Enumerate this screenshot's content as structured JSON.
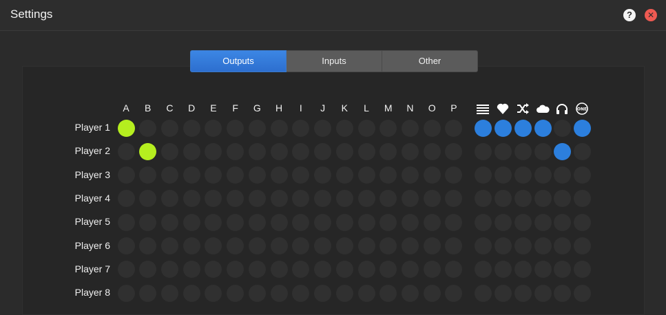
{
  "window": {
    "title": "Settings"
  },
  "controls": {
    "help_label": "?",
    "close_label": "✕"
  },
  "tabs": [
    {
      "label": "Outputs",
      "active": true
    },
    {
      "label": "Inputs",
      "active": false
    },
    {
      "label": "Other",
      "active": false
    }
  ],
  "columns": [
    "A",
    "B",
    "C",
    "D",
    "E",
    "F",
    "G",
    "H",
    "I",
    "J",
    "K",
    "L",
    "M",
    "N",
    "O",
    "P"
  ],
  "option_icons": [
    "list-icon",
    "heart-icon",
    "shuffle-icon",
    "cloud-icon",
    "headphones-icon",
    "one-icon"
  ],
  "players": [
    {
      "label": "Player 1",
      "outputs": [
        "A"
      ],
      "options": [
        true,
        true,
        true,
        true,
        false,
        true
      ]
    },
    {
      "label": "Player 2",
      "outputs": [
        "B"
      ],
      "options": [
        false,
        false,
        false,
        false,
        true,
        false
      ]
    },
    {
      "label": "Player 3",
      "outputs": [],
      "options": [
        false,
        false,
        false,
        false,
        false,
        false
      ]
    },
    {
      "label": "Player 4",
      "outputs": [],
      "options": [
        false,
        false,
        false,
        false,
        false,
        false
      ]
    },
    {
      "label": "Player 5",
      "outputs": [],
      "options": [
        false,
        false,
        false,
        false,
        false,
        false
      ]
    },
    {
      "label": "Player 6",
      "outputs": [],
      "options": [
        false,
        false,
        false,
        false,
        false,
        false
      ]
    },
    {
      "label": "Player 7",
      "outputs": [],
      "options": [
        false,
        false,
        false,
        false,
        false,
        false
      ]
    },
    {
      "label": "Player 8",
      "outputs": [],
      "options": [
        false,
        false,
        false,
        false,
        false,
        false
      ]
    }
  ],
  "colors": {
    "output_on": "#b5ee1f",
    "option_on": "#2c7fdd",
    "off": "#303030",
    "tab_active": "#2f74d6"
  }
}
